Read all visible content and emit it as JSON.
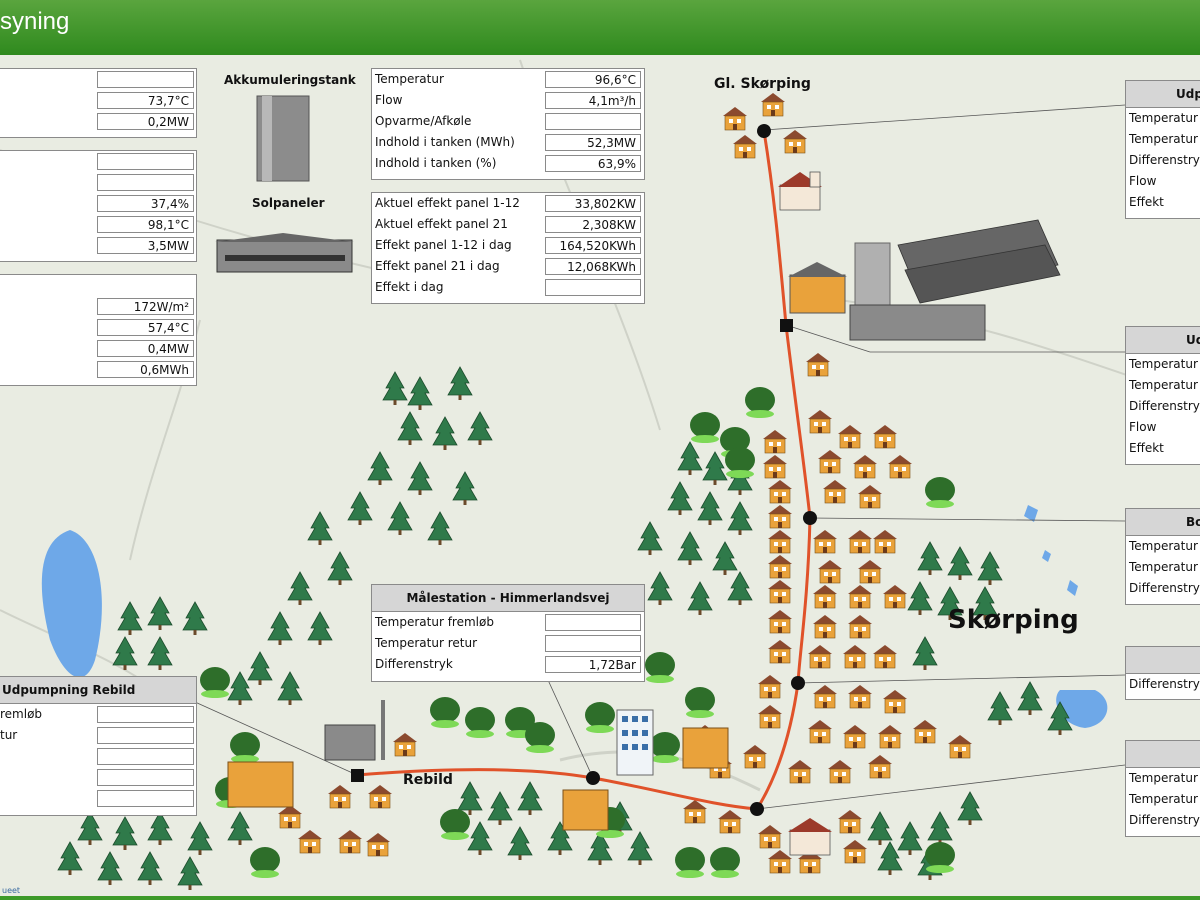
{
  "header": {
    "title": "syning"
  },
  "map": {
    "labels": {
      "gl_skorping": "Gl. Skørping",
      "rebild": "Rebild",
      "skorping": "Skørping",
      "akkumuleringstank": "Akkumuleringstank",
      "solpaneler": "Solpaneler"
    }
  },
  "left_panel_1": {
    "values": [
      "",
      "73,7°C",
      "0,2MW"
    ]
  },
  "left_panel_2": {
    "values": [
      "",
      "",
      "37,4%",
      "98,1°C",
      "3,5MW"
    ]
  },
  "left_panel_3": {
    "values": [
      "172W/m²",
      "57,4°C",
      "0,4MW",
      "0,6MWh"
    ]
  },
  "tank_panel": {
    "rows": [
      {
        "label": "Temperatur",
        "value": "96,6°C"
      },
      {
        "label": "Flow",
        "value": "4,1m³/h"
      },
      {
        "label": "Opvarme/Afkøle",
        "value": ""
      },
      {
        "label": "Indhold i tanken (MWh)",
        "value": "52,3MW"
      },
      {
        "label": "Indhold i tanken (%)",
        "value": "63,9%"
      }
    ]
  },
  "solar_panel": {
    "rows": [
      {
        "label": "Aktuel effekt panel 1-12",
        "value": "33,802KW"
      },
      {
        "label": "Aktuel effekt panel 21",
        "value": "2,308KW"
      },
      {
        "label": "Effekt panel 1-12 i dag",
        "value": "164,520KWh"
      },
      {
        "label": "Effekt panel 21 i dag",
        "value": "12,068KWh"
      },
      {
        "label": "Effekt i dag",
        "value": ""
      }
    ]
  },
  "maalestation": {
    "title": "Målestation - Himmerlandsvej",
    "rows": [
      {
        "label": "Temperatur fremløb",
        "value": ""
      },
      {
        "label": "Temperatur retur",
        "value": ""
      },
      {
        "label": "Differenstryk",
        "value": "1,72Bar"
      }
    ]
  },
  "rebild_panel": {
    "title": "Udpumpning Rebild",
    "rows": [
      {
        "label": "remløb",
        "value": ""
      },
      {
        "label": "tur",
        "value": ""
      },
      {
        "label": "",
        "value": ""
      },
      {
        "label": "",
        "value": ""
      },
      {
        "label": "",
        "value": ""
      }
    ]
  },
  "right_panels": [
    {
      "title": "Udp",
      "rows": [
        "Temperatur fr",
        "Temperatur re",
        "Differenstryk",
        "Flow",
        "Effekt"
      ]
    },
    {
      "title": "Ud",
      "rows": [
        "Temperatur fre",
        "Temperatur re",
        "Differenstryk",
        "Flow",
        "Effekt"
      ]
    },
    {
      "title": "Bo",
      "rows": [
        "Temperatur fr",
        "Temperatur re",
        "Differenstryk"
      ]
    },
    {
      "title": "",
      "rows": [
        "Differenstryk"
      ]
    },
    {
      "title": "",
      "rows": [
        "Temperatur fr",
        "Temperatur re",
        "Differenstryk"
      ]
    }
  ],
  "credit": "ueet",
  "colors": {
    "header": "#3d9a29",
    "pipe": "#e0522a",
    "tree": "#2f7a4a",
    "house": "#e9a23b"
  }
}
